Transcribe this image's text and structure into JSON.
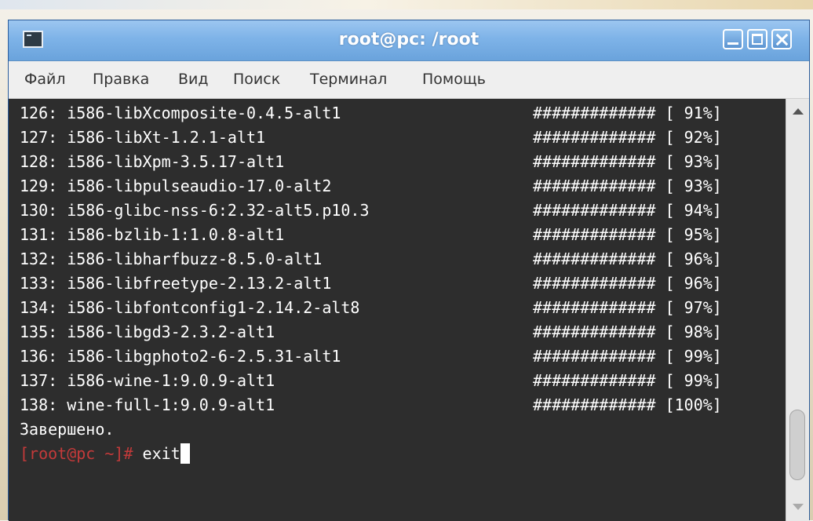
{
  "window": {
    "title": "root@pc: /root"
  },
  "menu": {
    "items": [
      "Файл",
      "Правка",
      "Вид",
      "Поиск",
      "Терминал",
      "Помощь"
    ]
  },
  "terminal": {
    "lines": [
      {
        "pkg": "126: i586-libXcomposite-0.4.5-alt1",
        "bar": "############# [ 91%]"
      },
      {
        "pkg": "127: i586-libXt-1.2.1-alt1",
        "bar": "############# [ 92%]"
      },
      {
        "pkg": "128: i586-libXpm-3.5.17-alt1",
        "bar": "############# [ 93%]"
      },
      {
        "pkg": "129: i586-libpulseaudio-17.0-alt2",
        "bar": "############# [ 93%]"
      },
      {
        "pkg": "130: i586-glibc-nss-6:2.32-alt5.p10.3",
        "bar": "############# [ 94%]"
      },
      {
        "pkg": "131: i586-bzlib-1:1.0.8-alt1",
        "bar": "############# [ 95%]"
      },
      {
        "pkg": "132: i586-libharfbuzz-8.5.0-alt1",
        "bar": "############# [ 96%]"
      },
      {
        "pkg": "133: i586-libfreetype-2.13.2-alt1",
        "bar": "############# [ 96%]"
      },
      {
        "pkg": "134: i586-libfontconfig1-2.14.2-alt8",
        "bar": "############# [ 97%]"
      },
      {
        "pkg": "135: i586-libgd3-2.3.2-alt1",
        "bar": "############# [ 98%]"
      },
      {
        "pkg": "136: i586-libgphoto2-6-2.5.31-alt1",
        "bar": "############# [ 99%]"
      },
      {
        "pkg": "137: i586-wine-1:9.0.9-alt1",
        "bar": "############# [ 99%]"
      },
      {
        "pkg": "138: wine-full-1:9.0.9-alt1",
        "bar": "############# [100%]"
      }
    ],
    "done_text": "Завершено.",
    "prompt": "[root@pc ~]#",
    "command": " exit"
  },
  "colors": {
    "terminal_bg": "#2d2d2d",
    "terminal_fg": "#ffffff",
    "prompt": "#c43a3a",
    "titlebar": "#7eb3e8"
  }
}
